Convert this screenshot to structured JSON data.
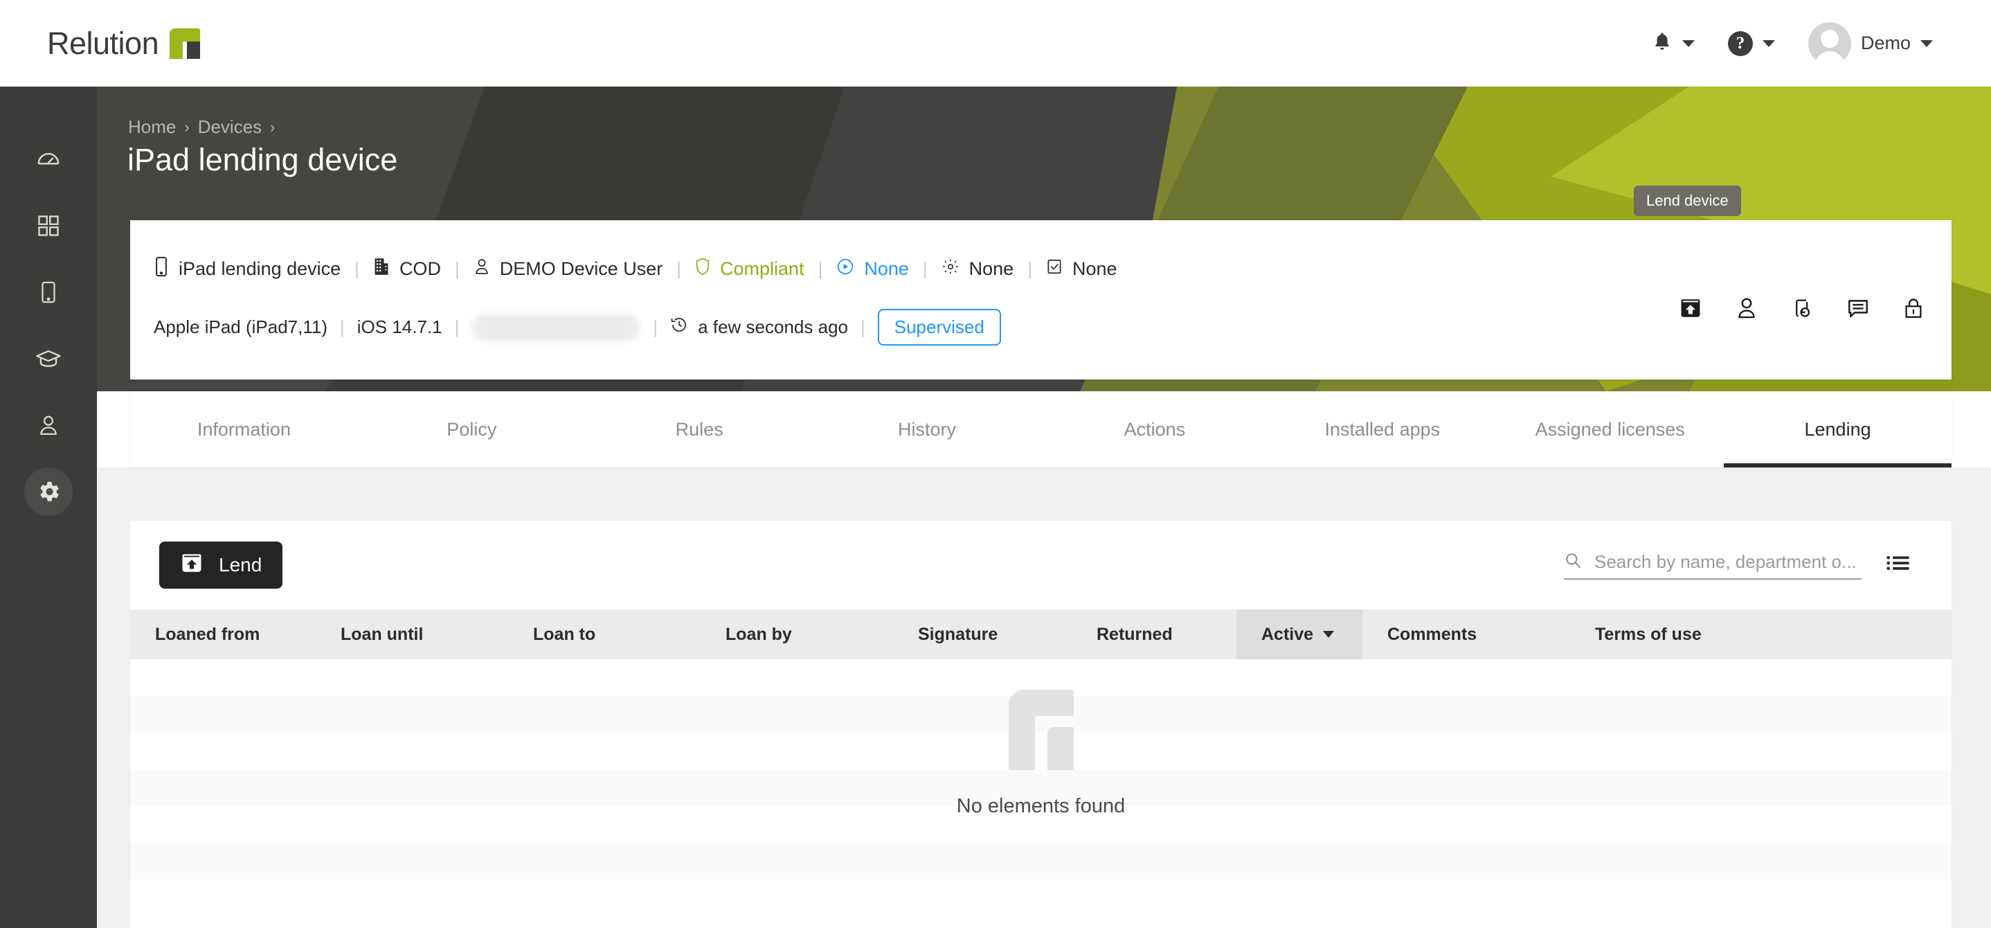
{
  "brand": {
    "name": "Relution",
    "accent_green": "#9fb51c",
    "dark": "#3c3c3b"
  },
  "topbar": {
    "notifications_icon": "bell-icon",
    "help_icon": "help-icon",
    "user_name": "Demo",
    "avatar_icon": "avatar"
  },
  "sidebar": {
    "items": [
      {
        "name": "dashboard",
        "icon": "gauge-icon",
        "active": false
      },
      {
        "name": "apps",
        "icon": "grid-icon",
        "active": false
      },
      {
        "name": "devices",
        "icon": "tablet-icon",
        "active": false
      },
      {
        "name": "education",
        "icon": "graduation-cap-icon",
        "active": false
      },
      {
        "name": "users",
        "icon": "user-icon",
        "active": false
      },
      {
        "name": "settings",
        "icon": "gear-icon",
        "active": true
      }
    ]
  },
  "breadcrumb": {
    "items": [
      "Home",
      "Devices"
    ],
    "separator": "›"
  },
  "page": {
    "title": "iPad lending device"
  },
  "device_card": {
    "row1": {
      "device_name": "iPad lending device",
      "organization": "COD",
      "owner": "DEMO Device User",
      "compliance": "Compliant",
      "media": "None",
      "settings": "None",
      "checks": "None"
    },
    "row2": {
      "model": "Apple iPad (iPad7,11)",
      "os": "iOS 14.7.1",
      "serial_masked": "",
      "last_seen": "a few seconds ago",
      "supervision_badge": "Supervised"
    },
    "actions": [
      {
        "name": "lend-device",
        "icon": "lend-icon",
        "active": true
      },
      {
        "name": "assign-user",
        "icon": "user-icon",
        "active": false
      },
      {
        "name": "device-restore",
        "icon": "device-restore-icon",
        "active": false
      },
      {
        "name": "send-message",
        "icon": "message-icon",
        "active": false
      },
      {
        "name": "lock-device",
        "icon": "lock-icon",
        "active": false
      }
    ],
    "tooltip": "Lend device"
  },
  "tabs": [
    {
      "label": "Information",
      "active": false
    },
    {
      "label": "Policy",
      "active": false
    },
    {
      "label": "Rules",
      "active": false
    },
    {
      "label": "History",
      "active": false
    },
    {
      "label": "Actions",
      "active": false
    },
    {
      "label": "Installed apps",
      "active": false
    },
    {
      "label": "Assigned licenses",
      "active": false
    },
    {
      "label": "Lending",
      "active": true
    }
  ],
  "lending_panel": {
    "lend_button_label": "Lend",
    "lend_button_icon": "lend-icon",
    "search": {
      "placeholder": "Search by name, department o...",
      "value": "",
      "icon": "search-icon"
    },
    "columns_icon": "columns-icon",
    "table": {
      "headers": [
        "Loaned from",
        "Loan until",
        "Loan to",
        "Loan by",
        "Signature",
        "Returned",
        "Active",
        "Comments",
        "Terms of use"
      ],
      "sorted_column": "Active",
      "sort_direction": "desc",
      "rows": [],
      "empty_message": "No elements found"
    }
  }
}
